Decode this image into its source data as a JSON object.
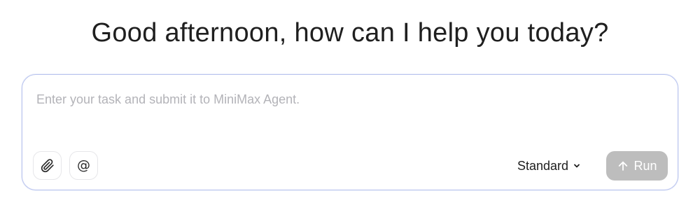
{
  "header": {
    "greeting": "Good afternoon, how can I help you today?"
  },
  "composer": {
    "input_placeholder": "Enter your task and submit it to MiniMax Agent.",
    "input_value": "",
    "attach_icon": "paperclip-icon",
    "mention_icon": "at-sign-icon",
    "mention_glyph": "@",
    "mode_label": "Standard",
    "mode_icon": "chevron-down-icon",
    "run_label": "Run",
    "run_icon": "arrow-up-icon"
  },
  "colors": {
    "run_button_disabled": "#bdbdbd",
    "composer_border": "#b9c3ee",
    "placeholder_text": "#b3b3b8"
  }
}
